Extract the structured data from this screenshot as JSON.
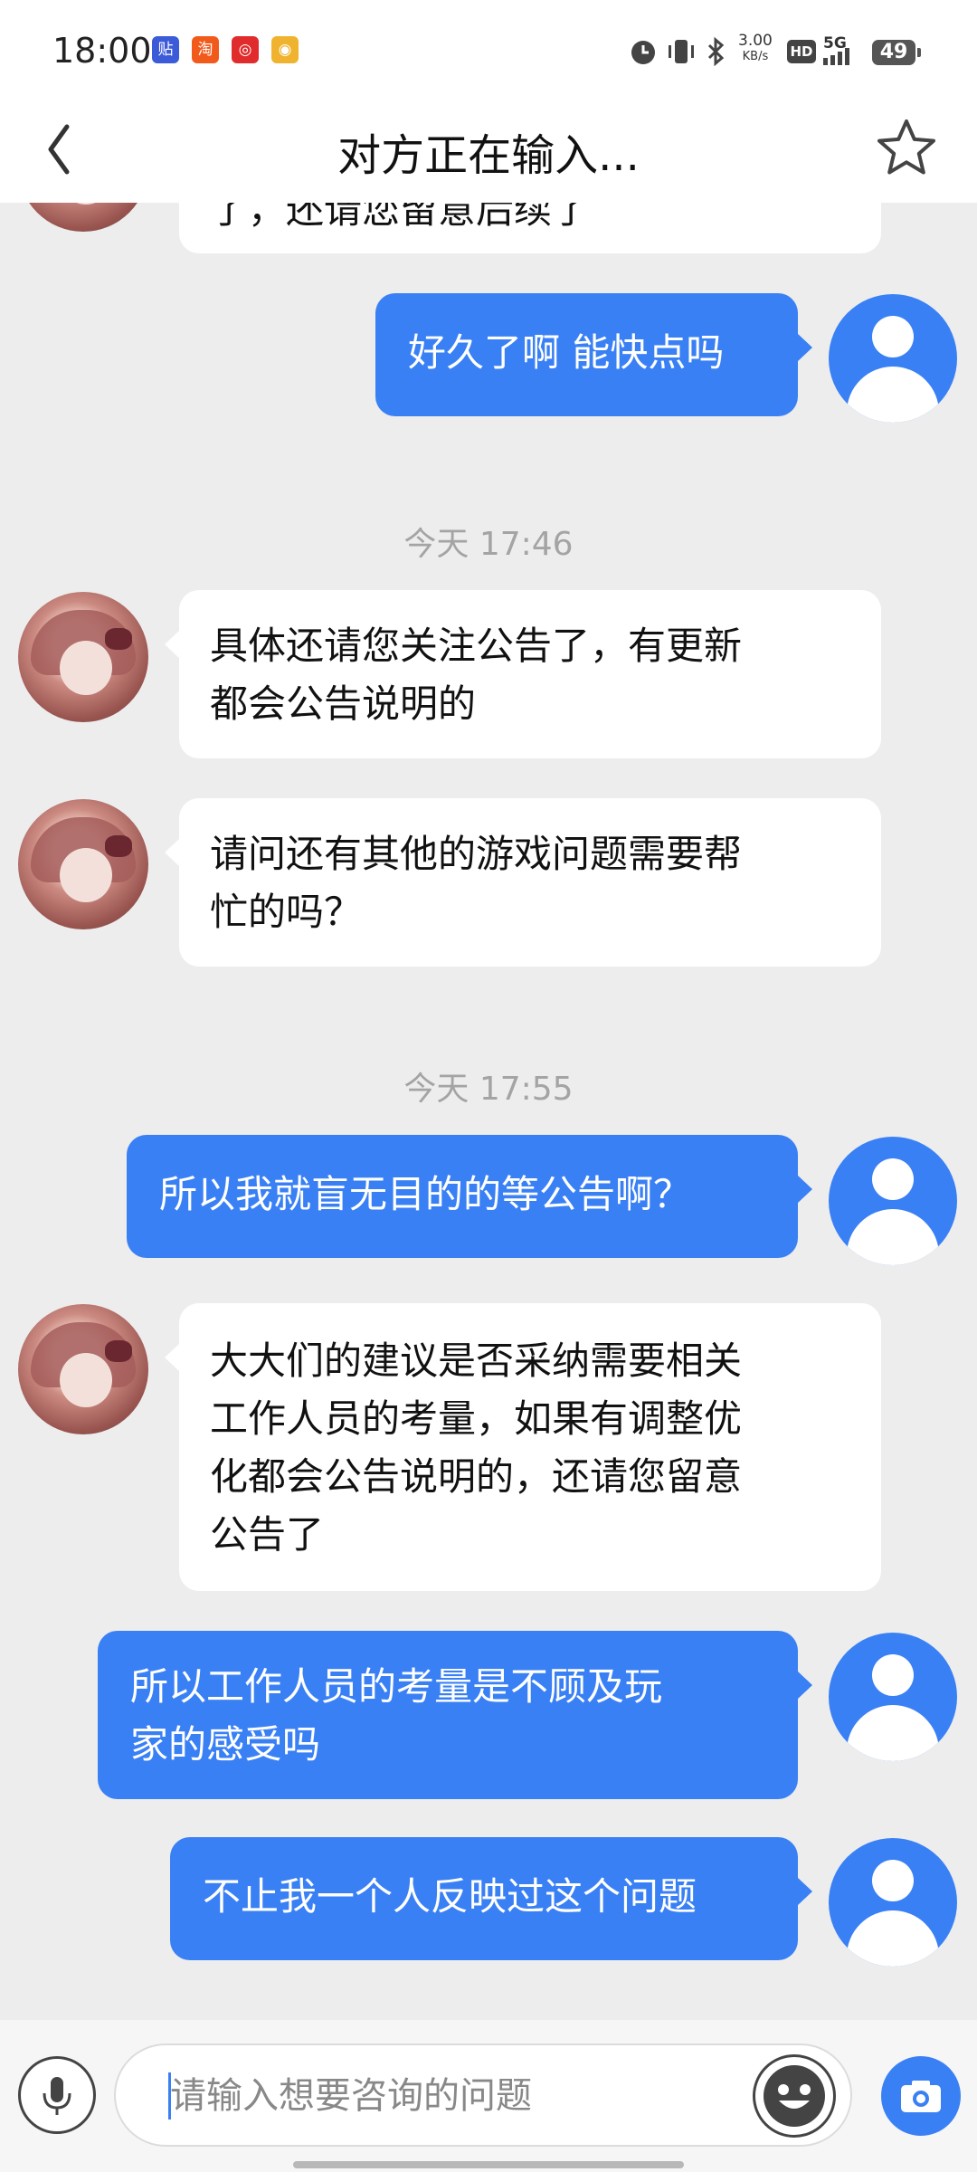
{
  "status_bar": {
    "time": "18:00",
    "app_icons": [
      {
        "name": "tieba-icon",
        "glyph": "贴",
        "color": "#3b5bd8"
      },
      {
        "name": "taobao-icon",
        "glyph": "淘",
        "color": "#f25a1c"
      },
      {
        "name": "netease-music-icon",
        "glyph": "◎",
        "color": "#e02c2c"
      },
      {
        "name": "weibo-icon",
        "glyph": "◉",
        "color": "#f0b330"
      }
    ],
    "speed": "3.00",
    "speed_unit": "KB/s",
    "hd": "HD",
    "network": "5G",
    "battery": "49"
  },
  "header": {
    "back_icon": "chevron-left-icon",
    "title": "对方正在输入...",
    "favorite_icon": "star-outline-icon"
  },
  "messages": [
    {
      "side": "left",
      "text": "了，还请您留意后续了"
    },
    {
      "side": "right",
      "text": "好久了啊 能快点吗"
    },
    {
      "side": "time",
      "text": "今天 17:46"
    },
    {
      "side": "left",
      "text": "具体还请您关注公告了，有更新\n都会公告说明的"
    },
    {
      "side": "left",
      "text": "请问还有其他的游戏问题需要帮\n忙的吗？"
    },
    {
      "side": "time",
      "text": "今天 17:55"
    },
    {
      "side": "right",
      "text": "所以我就盲无目的的等公告啊？"
    },
    {
      "side": "left",
      "text": "大大们的建议是否采纳需要相关\n工作人员的考量，如果有调整优\n化都会公告说明的，还请您留意\n公告了"
    },
    {
      "side": "right",
      "text": "所以工作人员的考量是不顾及玩\n家的感受吗"
    },
    {
      "side": "right",
      "text": "不止我一个人反映过这个问题"
    }
  ],
  "input_bar": {
    "voice_icon": "microphone-icon",
    "placeholder": "请输入想要咨询的问题",
    "emoji_icon": "smiley-icon",
    "camera_icon": "camera-icon"
  },
  "colors": {
    "accent": "#3a80f5",
    "background": "#ededed",
    "bubble_left": "#ffffff"
  }
}
